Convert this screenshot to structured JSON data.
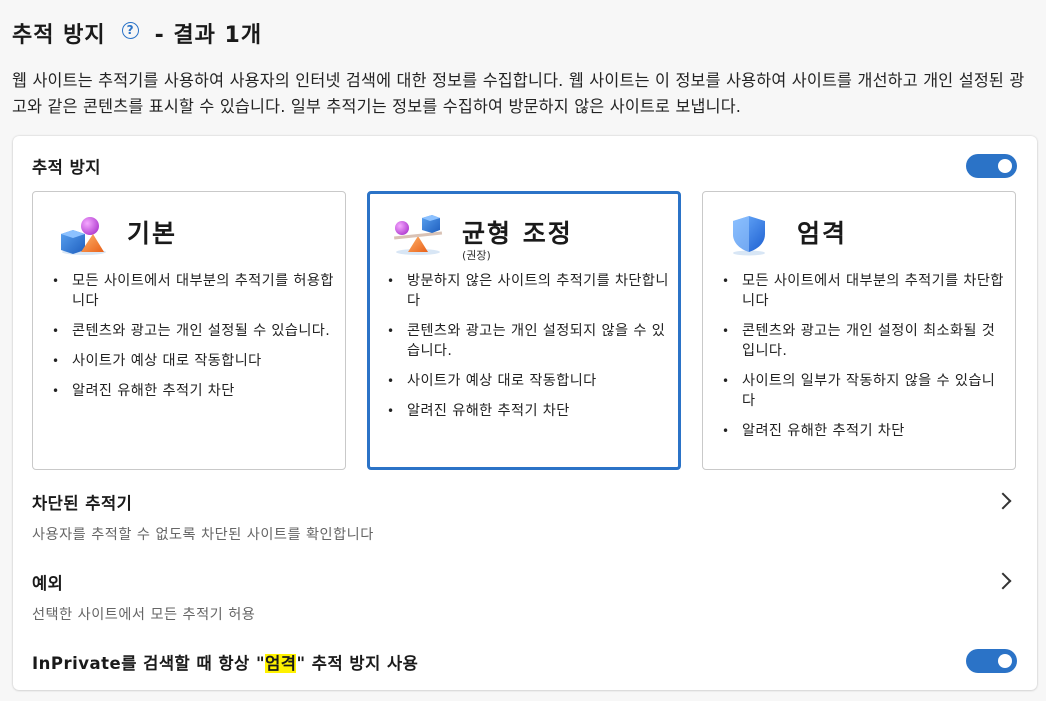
{
  "header": {
    "title": "추적 방지",
    "help_icon": "help-circle-icon",
    "result_text": "- 결과 1개"
  },
  "description": "웹 사이트는 추적기를 사용하여 사용자의 인터넷 검색에 대한 정보를 수집합니다. 웹 사이트는 이 정보를 사용하여 사이트를 개선하고 개인 설정된 광고와 같은 콘텐츠를 표시할 수 있습니다. 일부 추적기는 정보를 수집하여 방문하지 않은 사이트로 보냅니다.",
  "tracking": {
    "label": "추적 방지",
    "toggle_on": true
  },
  "cards": [
    {
      "title": "기본",
      "subtitle": "",
      "icon": "shapes-basic-icon",
      "selected": false,
      "bullets": [
        "모든 사이트에서 대부분의 추적기를 허용합니다",
        "콘텐츠와 광고는 개인 설정될 수 있습니다.",
        "사이트가 예상 대로 작동합니다",
        "알려진 유해한 추적기 차단"
      ]
    },
    {
      "title": "균형 조정",
      "subtitle": "(권장)",
      "icon": "balance-scale-icon",
      "selected": true,
      "bullets": [
        "방문하지 않은 사이트의 추적기를 차단합니다",
        "콘텐츠와 광고는 개인 설정되지 않을 수 있습니다.",
        "사이트가 예상 대로 작동합니다",
        "알려진 유해한 추적기 차단"
      ]
    },
    {
      "title": "엄격",
      "subtitle": "",
      "icon": "shield-icon",
      "selected": false,
      "bullets": [
        "모든 사이트에서 대부분의 추적기를 차단합니다",
        "콘텐츠와 광고는 개인 설정이 최소화될 것입니다.",
        "사이트의 일부가 작동하지 않을 수 있습니다",
        "알려진 유해한 추적기 차단"
      ]
    }
  ],
  "blocked": {
    "title": "차단된 추적기",
    "subtitle": "사용자를 추적할 수 없도록 차단된 사이트를 확인합니다"
  },
  "exceptions": {
    "title": "예외",
    "subtitle": "선택한 사이트에서 모든 추적기 허용"
  },
  "inprivate": {
    "label_before": "InPrivate를 검색할 때 항상 \"",
    "label_highlight": "엄격",
    "label_after": "\" 추적 방지 사용",
    "toggle_on": true
  },
  "colors": {
    "accent": "#2b73c7",
    "highlight": "#fff200"
  }
}
